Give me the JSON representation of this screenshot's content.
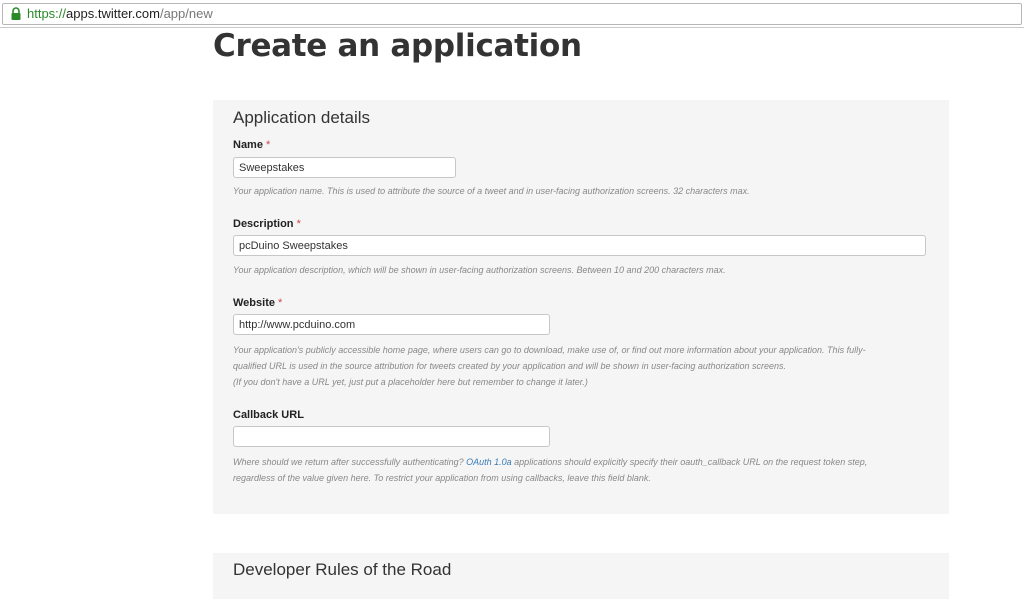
{
  "browser": {
    "url_scheme": "https://",
    "url_host": "apps.twitter.com",
    "url_path": "/app/new"
  },
  "page": {
    "title": "Create an application"
  },
  "details": {
    "section_title": "Application details",
    "required_mark": "*",
    "name": {
      "label": "Name",
      "value": "Sweepstakes",
      "help": "Your application name. This is used to attribute the source of a tweet and in user-facing authorization screens. 32 characters max."
    },
    "description": {
      "label": "Description",
      "value": "pcDuino Sweepstakes",
      "help": "Your application description, which will be shown in user-facing authorization screens. Between 10 and 200 characters max."
    },
    "website": {
      "label": "Website",
      "value": "http://www.pcduino.com",
      "help_line1": "Your application's publicly accessible home page, where users can go to download, make use of, or find out more information about your application. This fully-",
      "help_line2": "qualified URL is used in the source attribution for tweets created by your application and will be shown in user-facing authorization screens.",
      "help_line3": "(If you don't have a URL yet, just put a placeholder here but remember to change it later.)"
    },
    "callback": {
      "label": "Callback URL",
      "value": "",
      "help_before_link": "Where should we return after successfully authenticating? ",
      "help_link": "OAuth 1.0a",
      "help_after_link": " applications should explicitly specify their oauth_callback URL on the request token step,",
      "help_line2": "regardless of the value given here. To restrict your application from using callbacks, leave this field blank."
    }
  },
  "rules": {
    "section_title": "Developer Rules of the Road"
  },
  "colors": {
    "secure_green": "#2a8a2a",
    "required_red": "#d04646",
    "link_blue": "#3a7cb6",
    "panel_bg": "#f5f5f5"
  }
}
